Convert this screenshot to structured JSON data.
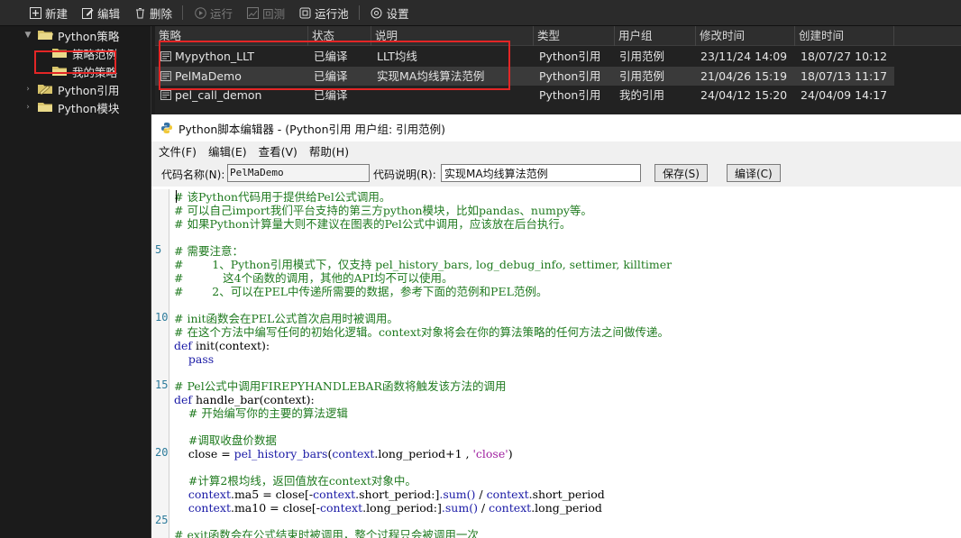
{
  "toolbar": {
    "new": "新建",
    "edit": "编辑",
    "delete": "删除",
    "run": "运行",
    "backtest": "回测",
    "run_pool": "运行池",
    "settings": "设置"
  },
  "tree": {
    "python_strategy": "Python策略",
    "strategy_sample": "策略范例",
    "my_strategy": "我的策略",
    "python_ref": "Python引用",
    "python_module": "Python模块"
  },
  "grid": {
    "headers": [
      "策略",
      "状态",
      "说明",
      "类型",
      "用户组",
      "修改时间",
      "创建时间"
    ],
    "rows": [
      {
        "name": "Mypython_LLT",
        "status": "已编译",
        "desc": "LLT均线",
        "type": "Python引用",
        "group": "引用范例",
        "modified": "23/11/24 14:09",
        "created": "18/07/27 10:12"
      },
      {
        "name": "PelMaDemo",
        "status": "已编译",
        "desc": "实现MA均线算法范例",
        "type": "Python引用",
        "group": "引用范例",
        "modified": "21/04/26 15:19",
        "created": "18/07/13 11:17"
      },
      {
        "name": "pel_call_demon",
        "status": "已编译",
        "desc": "",
        "type": "Python引用",
        "group": "我的引用",
        "modified": "24/04/12 15:20",
        "created": "24/04/09 14:17"
      }
    ]
  },
  "editor": {
    "title": "Python脚本编辑器 - (Python引用 用户组: 引用范例)",
    "menu": [
      "文件(F)",
      "编辑(E)",
      "查看(V)",
      "帮助(H)"
    ],
    "code_name_label": "代码名称(N):",
    "code_name_value": "PelMaDemo",
    "code_desc_label": "代码说明(R):",
    "code_desc_value": "实现MA均线算法范例",
    "save_button": "保存(S)",
    "compile_button": "编译(C)",
    "line_numbers": [
      "5",
      "10",
      "15",
      "20",
      "25"
    ],
    "code_lines": [
      "# 该Python代码用于提供给Pel公式调用。",
      "# 可以自己import我们平台支持的第三方python模块，比如pandas、numpy等。",
      "# 如果Python计算量大则不建议在图表的Pel公式中调用，应该放在后台执行。",
      "",
      "# 需要注意：",
      "#        1、Python引用模式下，仅支持 pel_history_bars, log_debug_info, settimer, killtimer",
      "#           这4个函数的调用，其他的API均不可以使用。",
      "#        2、可以在PEL中传递所需要的数据，参考下面的范例和PEL范例。",
      "",
      "# init函数会在PEL公式首次启用时被调用。",
      "# 在这个方法中编写任何的初始化逻辑。context对象将会在你的算法策略的任何方法之间做传递。",
      "def init(context):",
      "    pass",
      "",
      "# Pel公式中调用FIREPYHANDLEBAR函数将触发该方法的调用",
      "def handle_bar(context):",
      "    # 开始编写你的主要的算法逻辑",
      "",
      "    #调取收盘价数据",
      "    close = pel_history_bars(context.long_period+1 , 'close')",
      "",
      "    #计算2根均线，返回值放在context对象中。",
      "    context.ma5 = close[-context.short_period:].sum() / context.short_period",
      "    context.ma10 = close[-context.long_period:].sum() / context.long_period",
      "",
      "# exit函数会在公式结束时被调用，整个过程只会被调用一次"
    ]
  },
  "colors": {
    "selection_outline": "#e32626",
    "folder": "#d8c46a",
    "comment": "#1f7a1f",
    "keyword": "#1a1aa6"
  }
}
